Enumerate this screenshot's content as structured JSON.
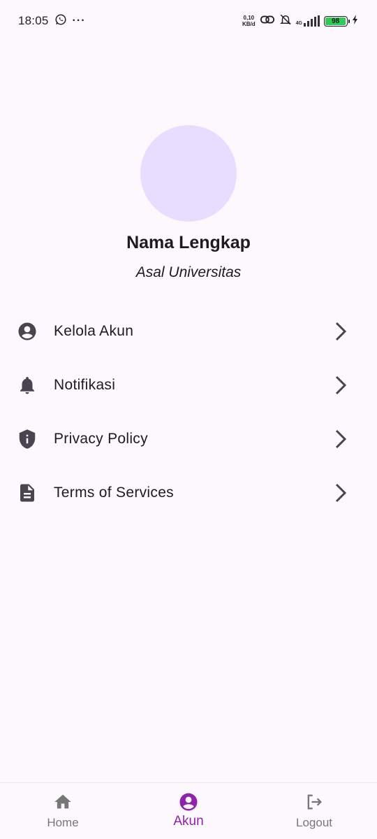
{
  "status_bar": {
    "time": "18:05",
    "more": "···",
    "speed_value": "0,10",
    "speed_unit": "KB/d",
    "network": "4G",
    "battery": "98"
  },
  "profile": {
    "name": "Nama Lengkap",
    "university": "Asal Universitas"
  },
  "menu": {
    "items": [
      {
        "label": "Kelola Akun",
        "icon": "account-circle-icon"
      },
      {
        "label": "Notifikasi",
        "icon": "bell-icon"
      },
      {
        "label": "Privacy Policy",
        "icon": "shield-info-icon"
      },
      {
        "label": "Terms of Services",
        "icon": "document-icon"
      }
    ]
  },
  "bottom_nav": {
    "items": [
      {
        "label": "Home",
        "icon": "home-icon",
        "active": false
      },
      {
        "label": "Akun",
        "icon": "account-circle-icon",
        "active": true
      },
      {
        "label": "Logout",
        "icon": "logout-icon",
        "active": false
      }
    ]
  },
  "colors": {
    "background": "#fdf7fe",
    "avatar": "#e9ddff",
    "accent": "#8e24aa",
    "icon": "#49454f",
    "inactive_nav": "#777777"
  }
}
